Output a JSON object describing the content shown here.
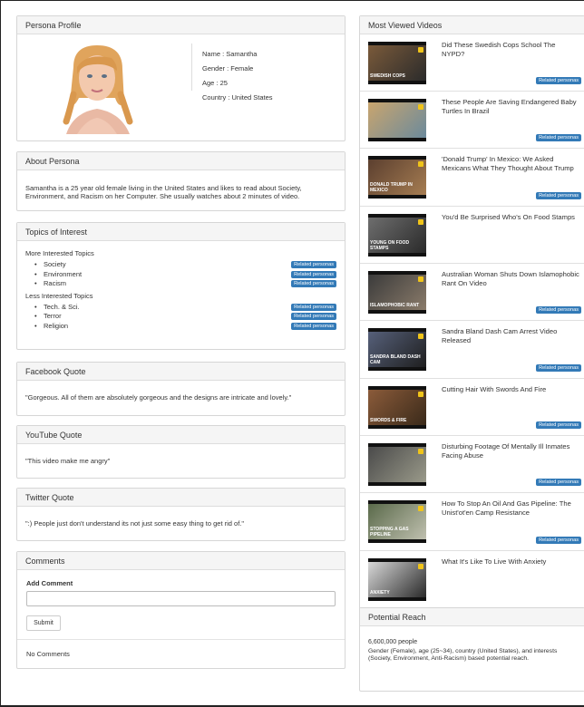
{
  "persona_profile": {
    "title": "Persona Profile",
    "name_line": "Name : Samantha",
    "gender_line": "Gender : Female",
    "age_line": "Age : 25",
    "country_line": "Country : United States"
  },
  "about": {
    "title": "About Persona",
    "text": "Samantha is a 25 year old female living in the United States and likes to read about Society, Environment, and Racism on her Computer. She usually watches about 2 minutes of video."
  },
  "topics": {
    "title": "Topics of Interest",
    "more_label": "More Interested Topics",
    "less_label": "Less Interested Topics",
    "bullet": "•",
    "badge_label": "Related personas",
    "more": [
      "Society",
      "Environment",
      "Racism"
    ],
    "less": [
      "Tech. & Sci.",
      "Terror",
      "Religion"
    ]
  },
  "facebook": {
    "title": "Facebook Quote",
    "quote": "\"Gorgeous. All of them are absolutely gorgeous and the designs are intricate and lovely.\""
  },
  "youtube": {
    "title": "YouTube Quote",
    "quote": "\"This video make me angry\""
  },
  "twitter": {
    "title": "Twitter Quote",
    "quote": "\":) People just don't understand its not just some easy thing to get rid of.\""
  },
  "comments": {
    "title": "Comments",
    "add_label": "Add Comment",
    "input_value": "",
    "submit_label": "Submit",
    "empty_text": "No Comments"
  },
  "videos": {
    "title": "Most Viewed Videos",
    "badge_label": "Related personas",
    "items": [
      {
        "title": "Did These Swedish Cops School The NYPD?",
        "caption": "SWEDISH COPS"
      },
      {
        "title": "These People Are Saving Endangered Baby Turtles In Brazil",
        "caption": ""
      },
      {
        "title": "'Donald Trump' In Mexico: We Asked Mexicans What They Thought About Trump",
        "caption": "DONALD TRUMP IN MEXICO"
      },
      {
        "title": "You'd Be Surprised Who's On Food Stamps",
        "caption": "YOUNG ON FOOD STAMPS"
      },
      {
        "title": "Australian Woman Shuts Down Islamophobic Rant On Video",
        "caption": "ISLAMOPHOBIC RANT"
      },
      {
        "title": "Sandra Bland Dash Cam Arrest Video Released",
        "caption": "SANDRA BLAND DASH CAM"
      },
      {
        "title": "Cutting Hair With Swords And Fire",
        "caption": "SWORDS & FIRE"
      },
      {
        "title": "Disturbing Footage Of Mentally Ill Inmates Facing Abuse",
        "caption": ""
      },
      {
        "title": "How To Stop An Oil And Gas Pipeline: The Unist'ot'en Camp Resistance",
        "caption": "STOPPING A GAS PIPELINE"
      },
      {
        "title": "What It's Like To Live With Anxiety",
        "caption": "ANXIETY"
      }
    ]
  },
  "reach": {
    "title": "Potential Reach",
    "people": "6,600,000 people",
    "detail": "Gender (Female), age (25~34), country (United States), and interests (Society, Environment, Anti-Racism) based potential reach."
  }
}
